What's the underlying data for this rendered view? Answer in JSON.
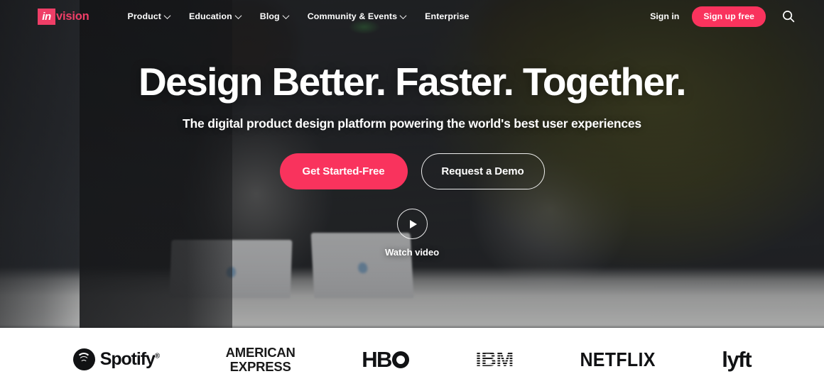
{
  "brand": {
    "logo_mark": "in",
    "logo_word": "vision",
    "accent_pink": "#f9335d",
    "logo_pink": "#ef3e67"
  },
  "nav": {
    "items": [
      {
        "label": "Product",
        "has_dropdown": true,
        "icon": "chevron-down-icon"
      },
      {
        "label": "Education",
        "has_dropdown": true,
        "icon": "chevron-down-icon"
      },
      {
        "label": "Blog",
        "has_dropdown": true,
        "icon": "chevron-down-icon"
      },
      {
        "label": "Community & Events",
        "has_dropdown": true,
        "icon": "chevron-down-icon"
      },
      {
        "label": "Enterprise",
        "has_dropdown": false,
        "icon": ""
      }
    ],
    "sign_in": "Sign in",
    "sign_up": "Sign up free",
    "search_icon": "search-icon"
  },
  "hero": {
    "headline": "Design Better. Faster. Together.",
    "subhead": "The digital product design platform powering the world's best user experiences",
    "cta_primary": "Get Started-Free",
    "cta_secondary": "Request a Demo",
    "watch_label": "Watch video",
    "play_icon": "play-icon"
  },
  "logobar": {
    "brands": [
      {
        "name": "Spotify",
        "word": "Spotify",
        "registered": "®",
        "icon": "spotify-icon"
      },
      {
        "name": "American Express",
        "line1": "AMERICAN",
        "line2": "EXPRESS",
        "icon": "amex-wordmark"
      },
      {
        "name": "HBO",
        "word": "HB",
        "icon": "hbo-wordmark"
      },
      {
        "name": "IBM",
        "word": "IBM",
        "icon": "ibm-wordmark"
      },
      {
        "name": "Netflix",
        "word": "NETFLIX",
        "icon": "netflix-wordmark"
      },
      {
        "name": "Lyft",
        "word": "lyft",
        "icon": "lyft-wordmark"
      }
    ]
  }
}
